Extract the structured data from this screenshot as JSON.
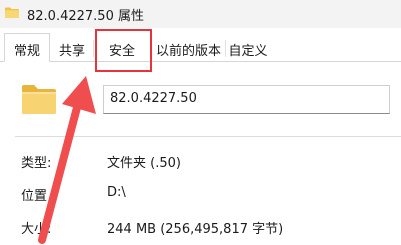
{
  "window": {
    "title": "82.0.4227.50 属性",
    "icon": "folder-icon"
  },
  "tabs": [
    {
      "label": "常规",
      "active": true
    },
    {
      "label": "共享",
      "active": false
    },
    {
      "label": "安全",
      "active": false
    },
    {
      "label": "以前的版本",
      "active": false
    },
    {
      "label": "自定义",
      "active": false
    }
  ],
  "general": {
    "folder_icon": "folder-icon",
    "name_value": "82.0.4227.50",
    "type_label": "类型:",
    "type_value": "文件夹 (.50)",
    "location_label": "位置",
    "location_value": "D:\\",
    "size_label": "大小:",
    "size_value": "244 MB (256,495,817 字节)"
  },
  "annotation": {
    "highlight_target": "安全",
    "color": "#e7333a",
    "arrow_icon": "red-arrow-icon"
  }
}
